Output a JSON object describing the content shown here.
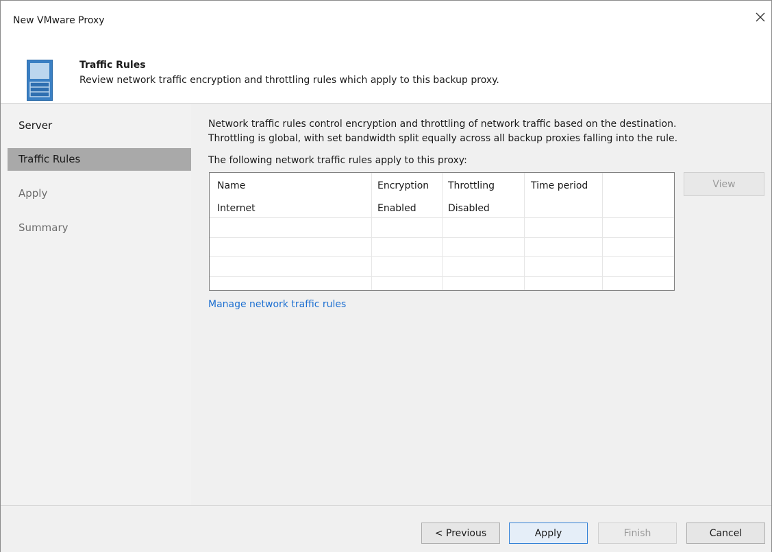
{
  "window": {
    "title": "New VMware Proxy"
  },
  "header": {
    "title": "Traffic Rules",
    "description": "Review network traffic encryption and throttling rules which apply to this backup proxy."
  },
  "sidebar": {
    "items": [
      {
        "label": "Server",
        "state": "done"
      },
      {
        "label": "Traffic Rules",
        "state": "active"
      },
      {
        "label": "Apply",
        "state": "pending"
      },
      {
        "label": "Summary",
        "state": "pending"
      }
    ]
  },
  "content": {
    "description_line1": "Network traffic rules control encryption and throttling of network traffic based on the destination.",
    "description_line2": "Throttling is global, with set bandwidth split equally across all backup proxies falling into the rule.",
    "subheading": "The following network traffic rules apply to this proxy:",
    "table": {
      "columns": [
        "Name",
        "Encryption",
        "Throttling",
        "Time period"
      ],
      "rows": [
        [
          "Internet",
          "Enabled",
          "Disabled",
          ""
        ]
      ]
    },
    "view_button": "View",
    "manage_link": "Manage network traffic rules"
  },
  "footer": {
    "previous": "< Previous",
    "apply": "Apply",
    "finish": "Finish",
    "cancel": "Cancel"
  },
  "colors": {
    "link": "#1c6fd1",
    "active_step": "#a9a9a9",
    "primary_border": "#2f7fd6"
  },
  "icons": {
    "close": "close-icon",
    "header": "server-icon"
  }
}
